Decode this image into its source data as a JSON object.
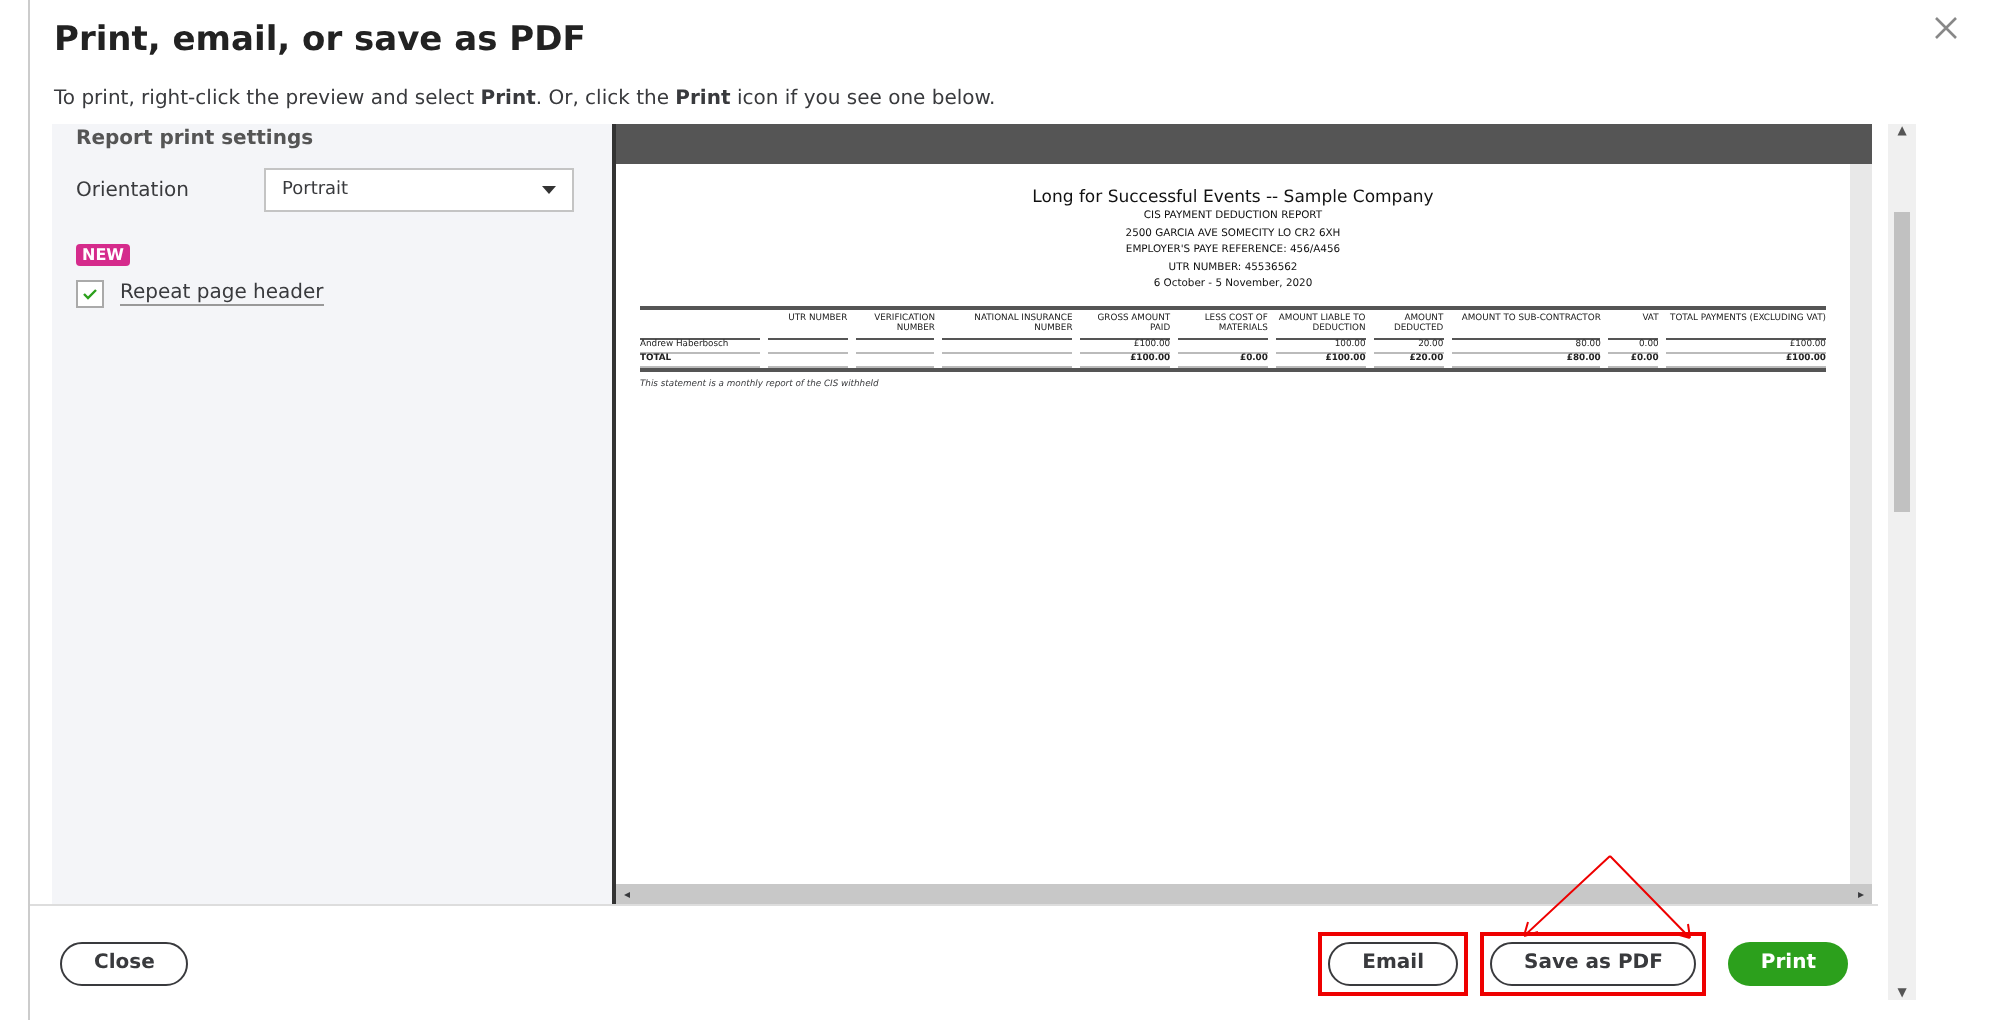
{
  "dialog": {
    "title": "Print, email, or save as PDF",
    "instructions": "To print, right-click the preview and select **Print**. Or, click the **Print** icon if you see one below."
  },
  "settings": {
    "heading": "Report print settings",
    "orientation_label": "Orientation",
    "orientation_value": "Portrait",
    "badge": "NEW",
    "repeat_header": {
      "label": "Repeat page header",
      "checked": true
    }
  },
  "report": {
    "title": "Long for Successful Events -- Sample Company",
    "subtitle_lines": [
      "CIS PAYMENT DEDUCTION REPORT",
      "2500 GARCIA AVE SOMECITY LO CR2 6XH",
      "EMPLOYER'S PAYE REFERENCE: 456/A456",
      "UTR NUMBER: 45536562",
      "6 October - 5 November, 2020"
    ],
    "columns": [
      "",
      "UTR NUMBER",
      "VERIFICATION NUMBER",
      "NATIONAL INSURANCE NUMBER",
      "GROSS AMOUNT PAID",
      "LESS COST OF MATERIALS",
      "AMOUNT LIABLE TO DEDUCTION",
      "AMOUNT DEDUCTED",
      "AMOUNT TO SUB-CONTRACTOR",
      "VAT",
      "TOTAL PAYMENTS (EXCLUDING VAT)"
    ],
    "rows": [
      {
        "kind": "data",
        "cells": [
          "Andrew Haberbosch",
          "",
          "",
          "",
          "£100.00",
          "",
          "100.00",
          "20.00",
          "80.00",
          "0.00",
          "£100.00"
        ]
      },
      {
        "kind": "total",
        "cells": [
          "TOTAL",
          "",
          "",
          "",
          "£100.00",
          "£0.00",
          "£100.00",
          "£20.00",
          "£80.00",
          "£0.00",
          "£100.00"
        ]
      }
    ],
    "footnote": "This statement is a monthly report of the CIS withheld"
  },
  "scroll_arrows": {
    "up": "▲",
    "down": "▼",
    "left": "◂",
    "right": "▸"
  },
  "buttons": [
    {
      "label": "Close",
      "kind": "outline",
      "highlighted": false
    },
    {
      "label": "Email",
      "kind": "outline",
      "highlighted": true
    },
    {
      "label": "Save as PDF",
      "kind": "outline",
      "highlighted": true
    },
    {
      "label": "Print",
      "kind": "primary",
      "highlighted": false
    }
  ]
}
